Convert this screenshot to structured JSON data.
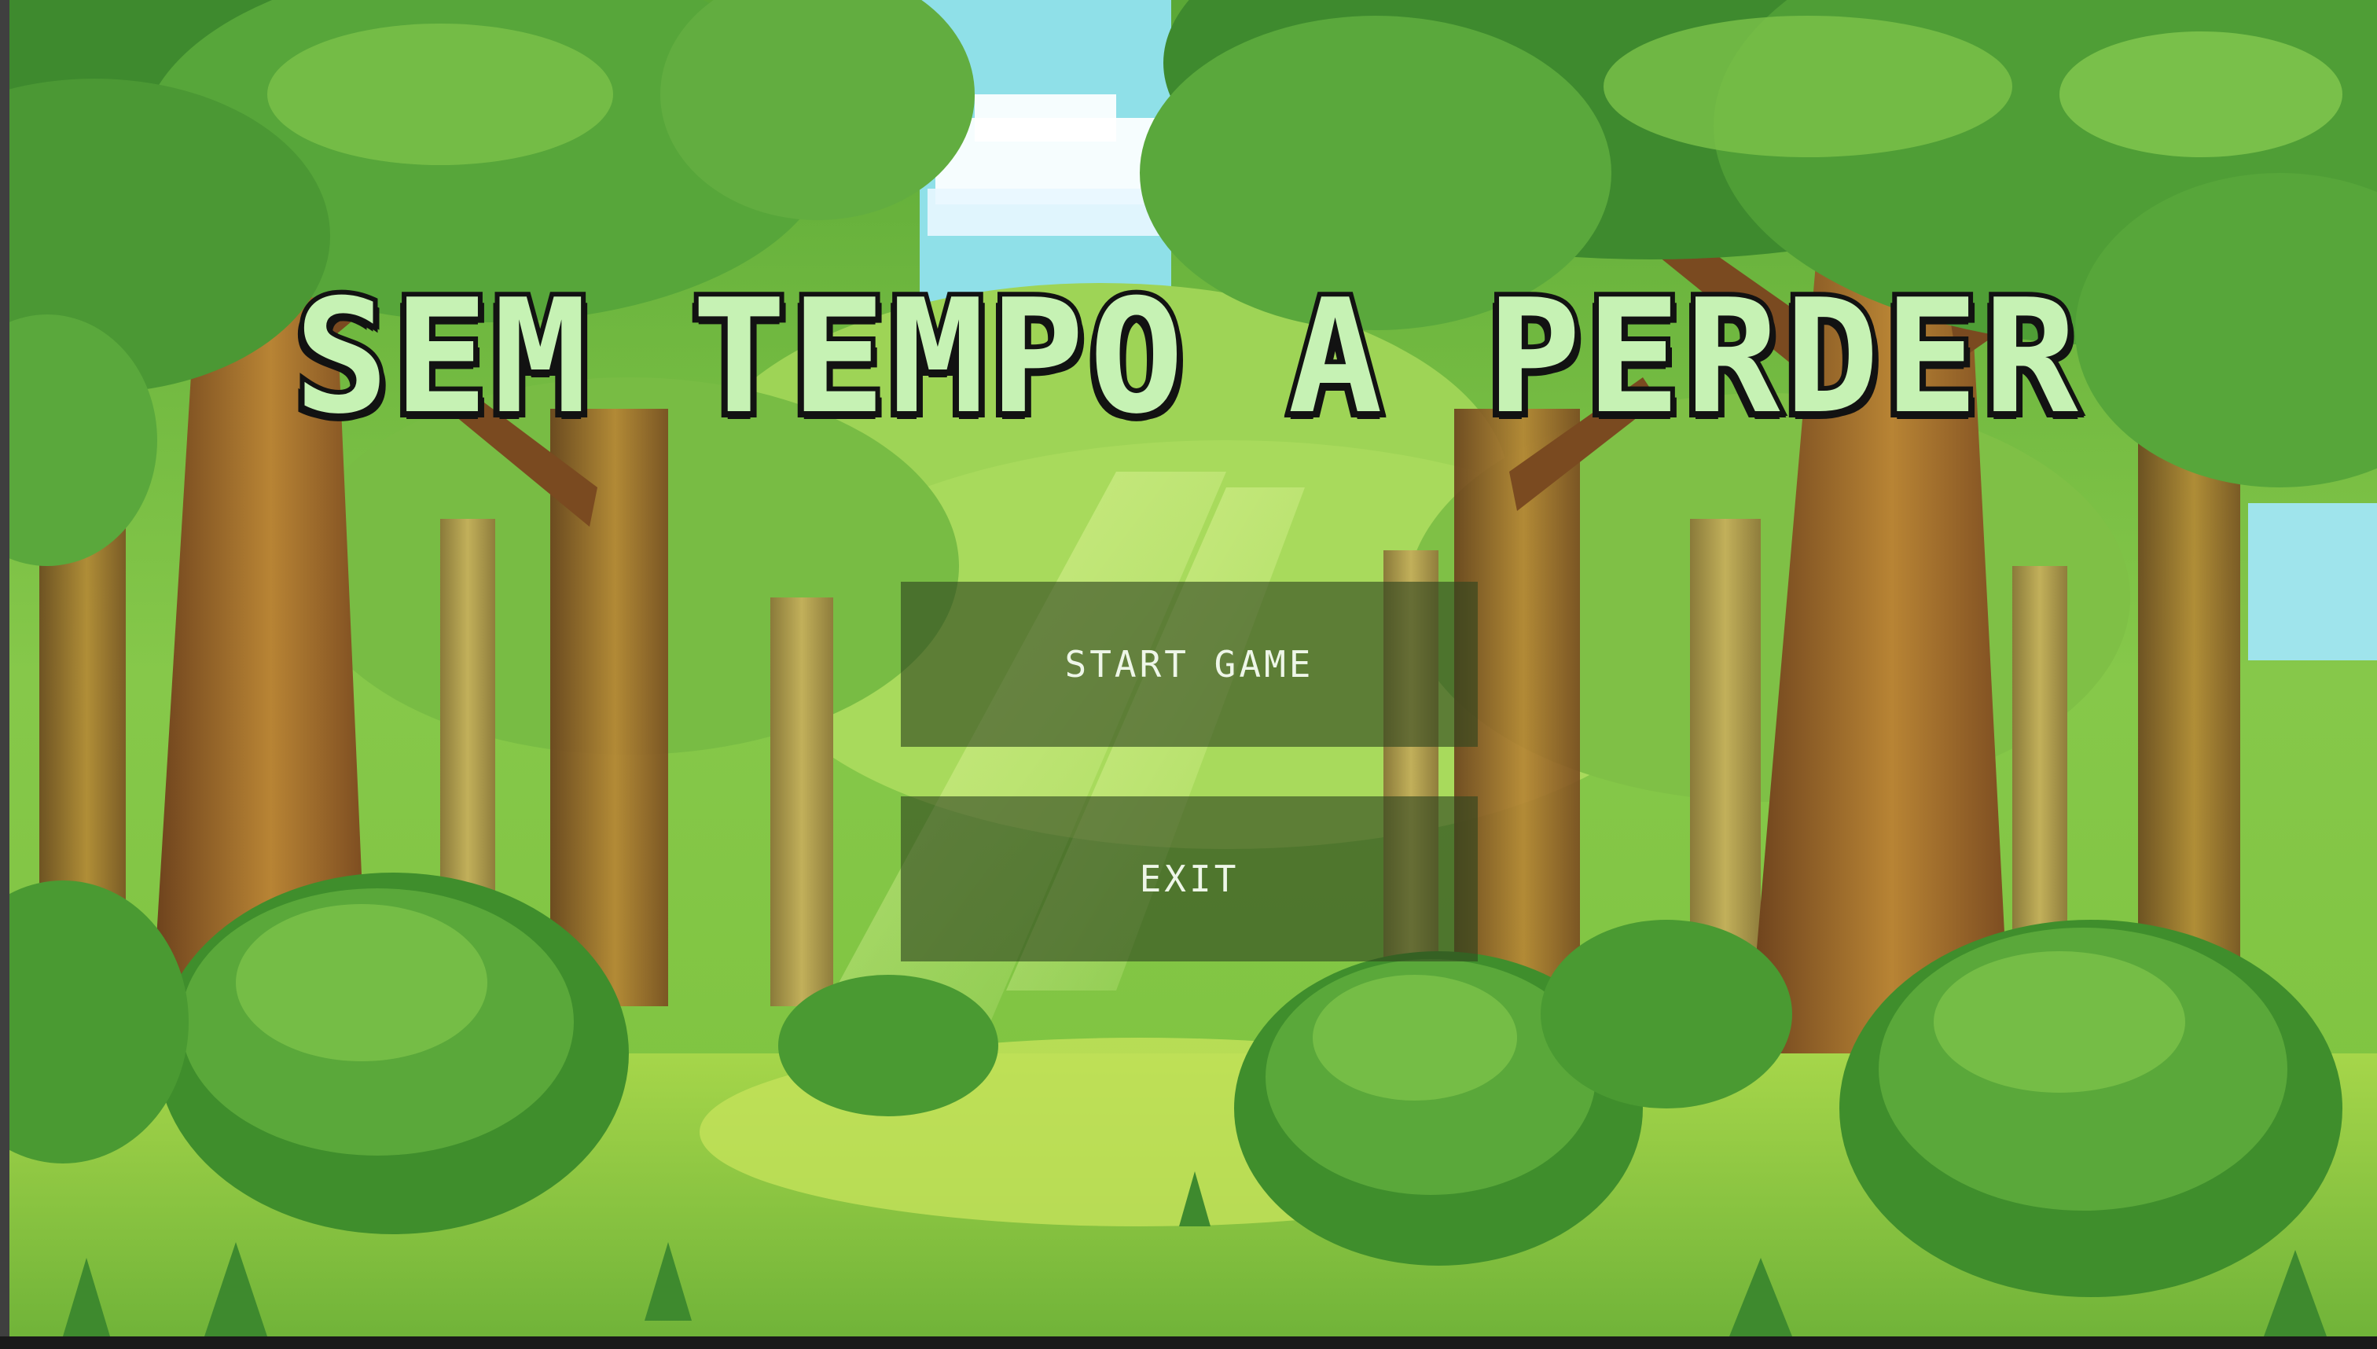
{
  "game": {
    "title": "SEM TEMPO A PERDER"
  },
  "menu": {
    "start_label": "START GAME",
    "exit_label": "EXIT"
  },
  "colors": {
    "title_fill": "#c6f2b4",
    "title_outline": "#121212",
    "button_bg": "rgba(46,70,30,0.62)",
    "button_text": "#eef6e8",
    "sky": "#8fe0e8",
    "foliage_dark": "#2f7a2a",
    "foliage_light": "#8fd14a",
    "trunk": "#8a5a28",
    "grass": "#7cc23c"
  }
}
